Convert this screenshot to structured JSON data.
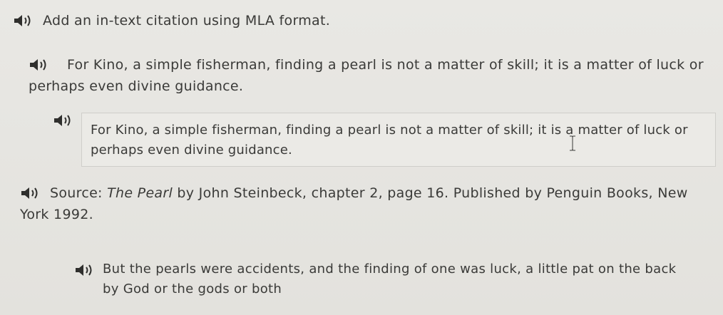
{
  "prompt": {
    "text": "Add an in-text citation using MLA format."
  },
  "quote": {
    "text": "For Kino, a simple fisherman, finding a pearl is not a matter of skill; it is a matter of luck or perhaps even divine guidance."
  },
  "answer": {
    "value": "For Kino, a simple fisherman, finding a pearl is not a matter of skill; it is a matter of luck or perhaps even divine guidance."
  },
  "source": {
    "prefix": "Source: ",
    "title": "The Pearl",
    "rest": " by John Steinbeck, chapter 2, page 16. Published by Penguin Books, New York 1992."
  },
  "pearls_quote": {
    "text": "But the pearls were accidents, and the finding of one was luck, a little pat on the back by God or the gods or both"
  },
  "icons": {
    "speaker": "speaker-audio-icon",
    "cursor": "text-cursor-icon"
  },
  "colors": {
    "text": "#3a3a38",
    "icon": "#2f2f2d",
    "box_border": "#cfceca"
  }
}
